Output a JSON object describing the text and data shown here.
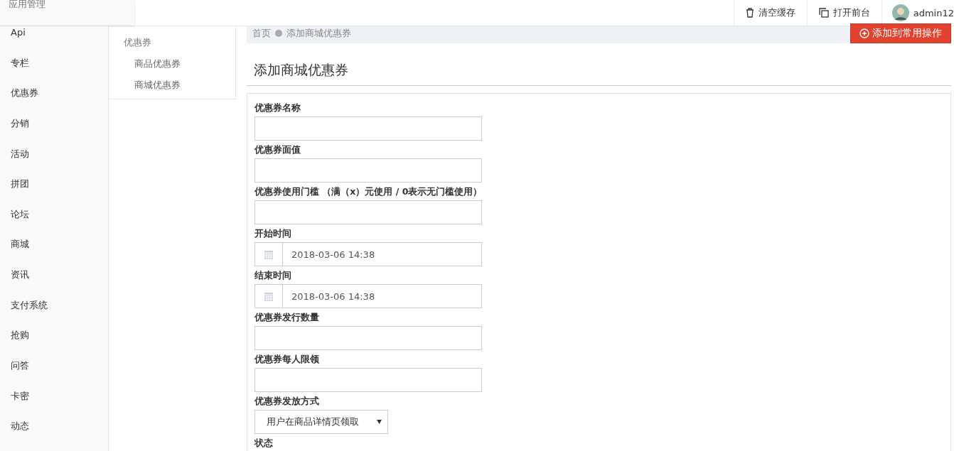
{
  "header": {
    "app_title": "应用管理",
    "actions": [
      {
        "kind": "trash",
        "label": "清空缓存"
      },
      {
        "kind": "copy",
        "label": "打开前台"
      }
    ],
    "user": {
      "name": "admin12"
    }
  },
  "sidebar": {
    "items": [
      "Api",
      "专栏",
      "优惠券",
      "分销",
      "活动",
      "拼团",
      "论坛",
      "商城",
      "资讯",
      "支付系统",
      "抢购",
      "问答",
      "卡密",
      "动态"
    ]
  },
  "subnav": {
    "title": "优惠券",
    "items": [
      "商品优惠券",
      "商城优惠券"
    ]
  },
  "breadcrumb": {
    "items": [
      "首页",
      "添加商城优惠券"
    ],
    "action": "添加到常用操作"
  },
  "page_title": "添加商城优惠券",
  "form": {
    "fields": [
      {
        "kind": "text",
        "label": "优惠券名称"
      },
      {
        "kind": "text",
        "label": "优惠券面值"
      },
      {
        "kind": "text",
        "label": "优惠券使用门槛 （满（x）元使用 / 0表示无门槛使用）"
      },
      {
        "kind": "date",
        "label": "开始时间",
        "value": "2018-03-06 14:38"
      },
      {
        "kind": "date",
        "label": "结束时间",
        "value": "2018-03-06 14:38"
      },
      {
        "kind": "text",
        "label": "优惠券发行数量"
      },
      {
        "kind": "text",
        "label": "优惠券每人限领"
      },
      {
        "kind": "select",
        "label": "优惠券发放方式",
        "value": "用户在商品详情页领取"
      },
      {
        "kind": "none",
        "label": "状态"
      }
    ]
  }
}
